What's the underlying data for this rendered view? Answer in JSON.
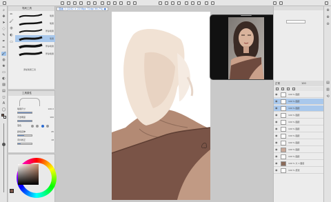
{
  "document": {
    "tab_title": "插画 1 (1242 × 2238px 72dpi 56.7%) ●"
  },
  "subtool": {
    "header": "笔刷工具",
    "brushes": [
      {
        "label": "笔刷"
      },
      {
        "label": "笔刷"
      },
      {
        "label": "厚涂笔刷"
      },
      {
        "label": "笔刷"
      },
      {
        "label": "厚涂笔刷"
      },
      {
        "label": "厚涂笔刷"
      }
    ],
    "add_label": "添加笔刷工具"
  },
  "toolprop": {
    "header": "工具属性",
    "rows": [
      {
        "label": "笔刷尺寸",
        "value": "100.0"
      },
      {
        "label": "不透明度",
        "value": "100"
      },
      {
        "label": "混色",
        "value": ""
      },
      {
        "label": "颜色延伸",
        "value": "45"
      },
      {
        "label": "手抖修正",
        "value": "18"
      }
    ]
  },
  "layers": {
    "items": [
      {
        "name": "100 % 图层"
      },
      {
        "name": "100 % 图层"
      },
      {
        "name": "100 % 图层"
      },
      {
        "name": "100 % 图层"
      },
      {
        "name": "100 % 图层"
      },
      {
        "name": "100 % 图层"
      },
      {
        "name": "100 % 图层"
      },
      {
        "name": "100 % 图层"
      },
      {
        "name": "100 % 图层"
      },
      {
        "name": "100 % 图层"
      },
      {
        "name": "100 % 大 1 图层"
      },
      {
        "name": "100 % 纸张"
      }
    ],
    "blend_mode": "正常",
    "opacity": "100"
  },
  "colors": {
    "accent": "#9ec3ec",
    "skin": "#f1e2d4",
    "top": "#7a5447"
  }
}
